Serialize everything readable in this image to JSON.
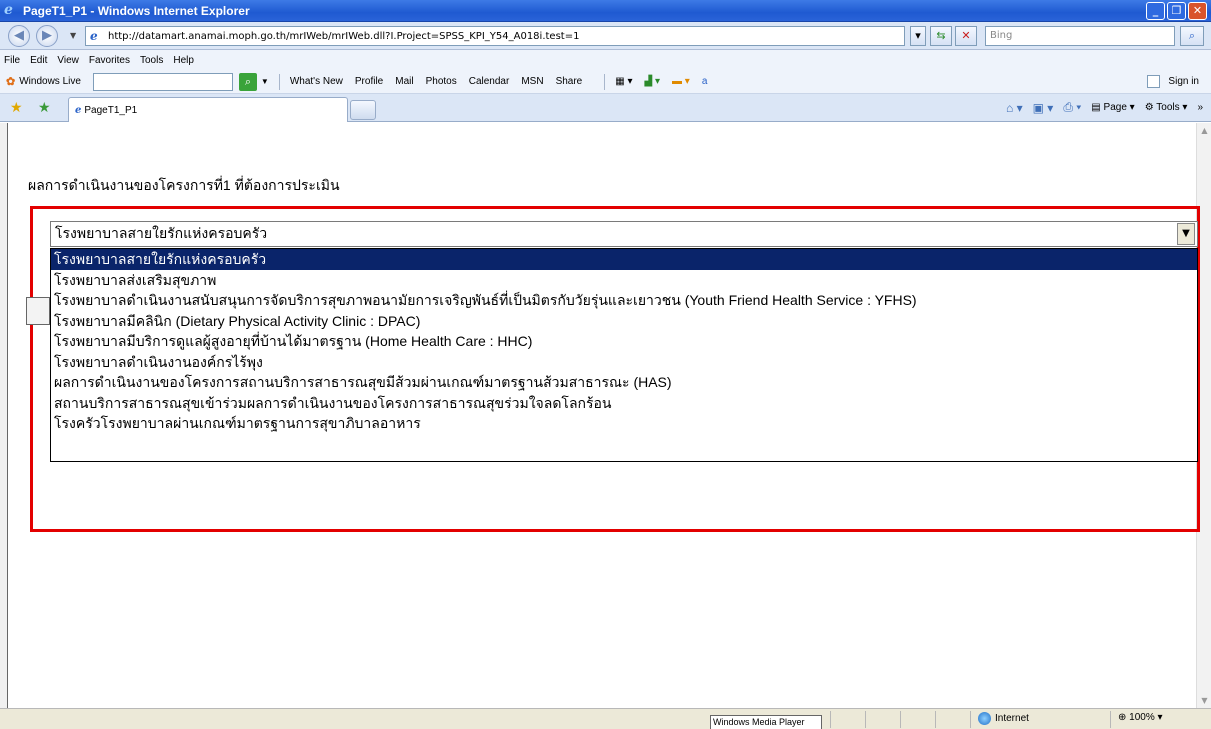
{
  "window": {
    "title": "PageT1_P1 - Windows Internet Explorer"
  },
  "address": {
    "url": "http://datamart.anamai.moph.go.th/mrIWeb/mrIWeb.dll?I.Project=SPSS_KPI_Y54_A018i.test=1",
    "search_placeholder": "Bing"
  },
  "menu": [
    "File",
    "Edit",
    "View",
    "Favorites",
    "Tools",
    "Help"
  ],
  "live_toolbar": {
    "brand": "Windows Live",
    "links": [
      "What's New",
      "Profile",
      "Mail",
      "Photos",
      "Calendar",
      "MSN",
      "Share"
    ],
    "sign_in": "Sign in"
  },
  "tabs": {
    "active": "PageT1_P1"
  },
  "commands": {
    "page": "Page",
    "tools": "Tools"
  },
  "page": {
    "heading": "ผลการดำเนินงานของโครงการที่1 ที่ต้องการประเมิน",
    "select_value": "โรงพยาบาลสายใยรักแห่งครอบครัว",
    "options": [
      "โรงพยาบาลสายใยรักแห่งครอบครัว",
      "โรงพยาบาลส่งเสริมสุขภาพ",
      "โรงพยาบาลดำเนินงานสนับสนุนการจัดบริการสุขภาพอนามัยการเจริญพันธ์ที่เป็นมิตรกับวัยรุ่นและเยาวชน (Youth Friend Health Service : YFHS)",
      "โรงพยาบาลมีคลินิก (Dietary Physical Activity Clinic : DPAC)",
      "โรงพยาบาลมีบริการดูแลผู้สูงอายุที่บ้านได้มาตรฐาน (Home Health Care : HHC)",
      "โรงพยาบาลดำเนินงานองค์กรไร้พุง",
      "ผลการดำเนินงานของโครงการสถานบริการสาธารณสุขมีส้วมผ่านเกณฑ์มาตรฐานส้วมสาธารณะ (HAS)",
      "สถานบริการสาธารณสุขเข้าร่วมผลการดำเนินงานของโครงการสาธารณสุขร่วมใจลดโลกร้อน",
      "โรงครัวโรงพยาบาลผ่านเกณฑ์มาตรฐานการสุขาภิบาลอาหาร"
    ],
    "selected_index": 0
  },
  "status": {
    "media": "Windows Media Player",
    "zone": "Internet",
    "zoom": "100%"
  }
}
